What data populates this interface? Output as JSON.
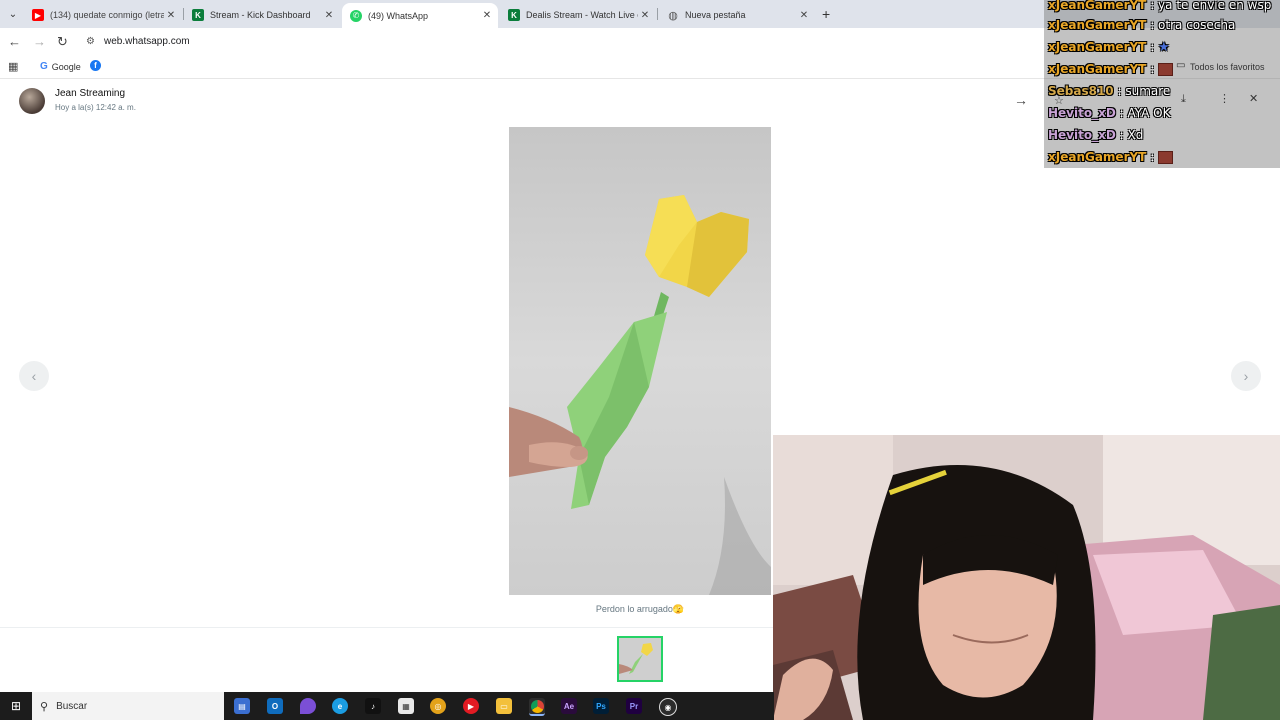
{
  "browser": {
    "tabs": [
      {
        "title": "(134) quedate conmigo (letra) -",
        "favicon": "youtube-icon",
        "active": false
      },
      {
        "title": "Stream - Kick Dashboard",
        "favicon": "kick-icon",
        "active": false
      },
      {
        "title": "(49) WhatsApp",
        "favicon": "whatsapp-icon",
        "active": true
      },
      {
        "title": "Dealis Stream - Watch Live on",
        "favicon": "kick-icon",
        "active": false
      },
      {
        "title": "Nueva pestaña",
        "favicon": "globe-icon",
        "active": false
      }
    ],
    "url": "web.whatsapp.com",
    "bookmarks": {
      "google_label": "Google",
      "all_bookmarks_label": "Todos los favoritos"
    }
  },
  "viewer": {
    "sender_name": "Jean Streaming",
    "timestamp": "Hoy a la(s) 12:42 a. m.",
    "caption": "Perdon lo arrugado🫣",
    "media_type": "photo",
    "photo_subject": "paper origami tulip held in hand"
  },
  "chat": {
    "messages": [
      {
        "user": "xJeanGamerYT",
        "text": "ya te envie en wsp",
        "user_color": "#e8a628"
      },
      {
        "user": "xJeanGamerYT",
        "text": "otra cosecha",
        "user_color": "#e8a628"
      },
      {
        "user": "xJeanGamerYT",
        "text": "",
        "emote": true,
        "user_color": "#e8a628"
      },
      {
        "user": "xJeanGamerYT",
        "text": "",
        "emote": true,
        "user_color": "#e8a628"
      },
      {
        "user": "Sebas810",
        "text": "sumare",
        "user_color": "#d4a84a"
      },
      {
        "user": "Hevito_xD",
        "text": "AYA OK",
        "user_color": "#c9a3d6"
      },
      {
        "user": "Hevito_xD",
        "text": "Xd",
        "user_color": "#c9a3d6"
      },
      {
        "user": "xJeanGamerYT",
        "text": "",
        "emote": true,
        "user_color": "#e8a628"
      }
    ]
  },
  "taskbar": {
    "search_placeholder": "Buscar",
    "apps": [
      "task-view-icon",
      "outlook-icon",
      "drop-icon",
      "edge-icon",
      "tiktok-icon",
      "calculator-icon",
      "chrome-canary-icon",
      "youtube-music-icon",
      "file-explorer-icon",
      "chrome-icon",
      "after-effects-icon",
      "photoshop-icon",
      "premiere-icon",
      "obs-icon"
    ]
  },
  "colors": {
    "whatsapp_green": "#25d366",
    "tab_bar": "#dfe3eb"
  }
}
